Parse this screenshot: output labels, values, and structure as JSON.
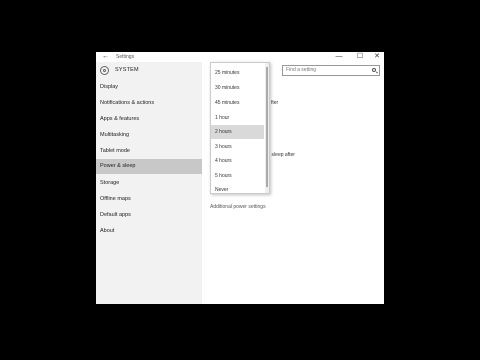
{
  "window": {
    "title": "Settings",
    "back_icon": "←",
    "minimize": "—",
    "maximize": "☐",
    "close": "✕"
  },
  "sidebar": {
    "header": "SYSTEM",
    "items": [
      {
        "label": "Display"
      },
      {
        "label": "Notifications & actions"
      },
      {
        "label": "Apps & features"
      },
      {
        "label": "Multitasking"
      },
      {
        "label": "Tablet mode"
      },
      {
        "label": "Power & sleep",
        "active": true
      },
      {
        "label": "Storage"
      },
      {
        "label": "Offline maps"
      },
      {
        "label": "Default apps"
      },
      {
        "label": "About"
      }
    ]
  },
  "search": {
    "placeholder": "Find a setting"
  },
  "content": {
    "partial_after": "fter",
    "partial_sleep": "to sleep after",
    "additional_link": "Additional power settings"
  },
  "dropdown": {
    "options": [
      "25 minutes",
      "30 minutes",
      "45 minutes",
      "1 hour",
      "2 hours",
      "3 hours",
      "4 hours",
      "5 hours",
      "Never"
    ],
    "selected": "2 hours"
  }
}
